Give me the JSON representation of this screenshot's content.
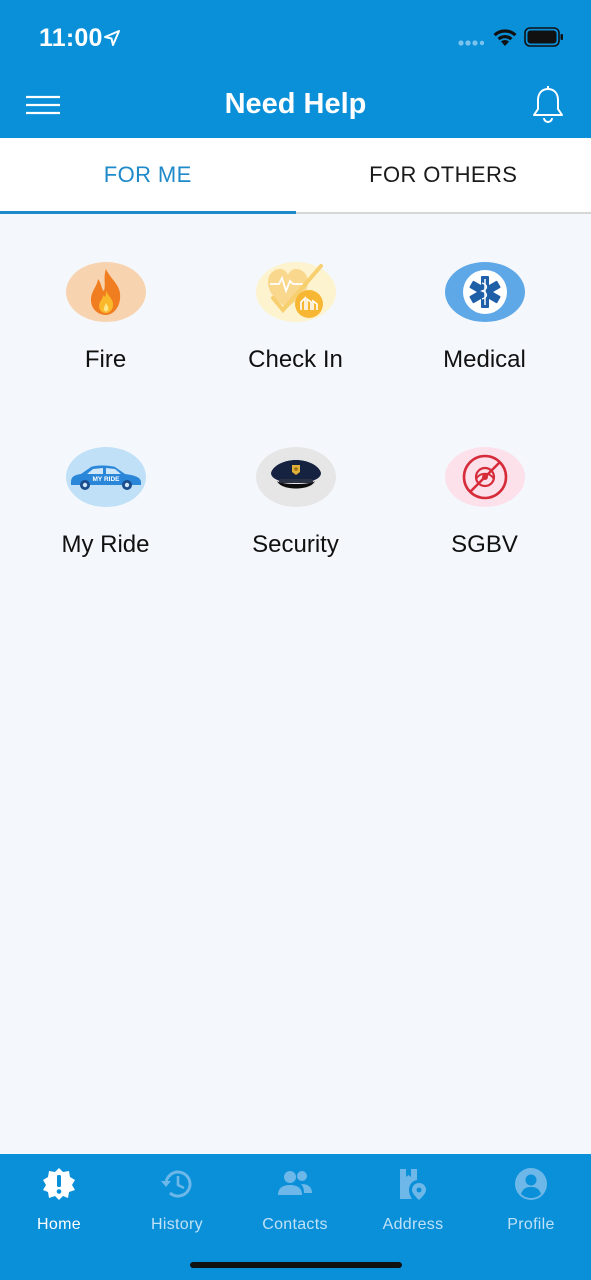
{
  "status_bar": {
    "time": "11:00"
  },
  "appbar": {
    "title": "Need Help"
  },
  "tabs": [
    {
      "label": "FOR ME",
      "active": true
    },
    {
      "label": "FOR OTHERS",
      "active": false
    }
  ],
  "services": [
    {
      "label": "Fire",
      "icon": "fire-icon"
    },
    {
      "label": "Check In",
      "icon": "heart-check-icon"
    },
    {
      "label": "Medical",
      "icon": "star-of-life-icon"
    },
    {
      "label": "My Ride",
      "icon": "car-icon",
      "badge_text": "MY RIDE"
    },
    {
      "label": "Security",
      "icon": "police-cap-icon"
    },
    {
      "label": "SGBV",
      "icon": "no-violence-icon"
    }
  ],
  "bottom_nav": [
    {
      "label": "Home",
      "icon": "alert-badge-icon",
      "active": true
    },
    {
      "label": "History",
      "icon": "history-icon",
      "active": false
    },
    {
      "label": "Contacts",
      "icon": "contacts-icon",
      "active": false
    },
    {
      "label": "Address",
      "icon": "address-icon",
      "active": false
    },
    {
      "label": "Profile",
      "icon": "profile-icon",
      "active": false
    }
  ],
  "colors": {
    "primary": "#0a8fd9",
    "tab_active": "#1f8ac9",
    "background": "#f4f8fc",
    "fire_bg": "#f7d3b0",
    "checkin_bg": "#fdf3cf",
    "medical_bg": "#5fa8e8",
    "ride_bg": "#bfe0f7",
    "security_bg": "#e6e6e6",
    "sgbv_bg": "#fce0ea"
  }
}
